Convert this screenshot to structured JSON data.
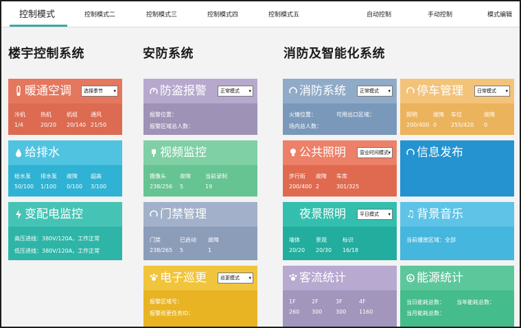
{
  "nav": {
    "tabs": [
      "控制模式",
      "控制模式二",
      "控制模式三",
      "控制模式四",
      "控制模式五"
    ],
    "right": [
      "自动控制",
      "手动控制",
      "模式编辑"
    ]
  },
  "sections": {
    "building": "楼宇控制系统",
    "security": "安防系统",
    "fire": "消防及智能化系统"
  },
  "colors": {
    "hvac": "#e5775e",
    "water": "#2fb6d8",
    "power": "#3cbbae",
    "alarm": "#a195b9",
    "video": "#73c89a",
    "access": "#8fa1bd",
    "patrol": "#e9b52c",
    "fire": "#7c9cbc",
    "lighting": "#e5775e",
    "landscape": "#26b1a2",
    "flow": "#a195b9",
    "parking": "#efb55c",
    "info": "#2593d0",
    "music": "#48b9e0",
    "energy": "#4cc08f"
  },
  "cards": {
    "hvac": {
      "title": "暖通空调",
      "select": "选择季节",
      "icon": "thermometer-icon",
      "stats": [
        {
          "label": "冷机",
          "value": "1/4"
        },
        {
          "label": "热机",
          "value": "20/20"
        },
        {
          "label": "机组",
          "value": "20/140"
        },
        {
          "label": "通风",
          "value": "21/50"
        }
      ]
    },
    "water": {
      "title": "给排水",
      "icon": "water-drop-icon",
      "stats": [
        {
          "label": "给水泵",
          "value": "50/100"
        },
        {
          "label": "排水泵",
          "value": "1/100"
        },
        {
          "label": "故障",
          "value": "0/100"
        },
        {
          "label": "超高",
          "value": "3/100"
        }
      ]
    },
    "power": {
      "title": "变配电监控",
      "icon": "lightning-icon",
      "lines": [
        "高压进线：380V/120A，工作正常",
        "低压进线：380V/120A，工作正常"
      ]
    },
    "alarm": {
      "title": "防盗报警",
      "select": "正常模式",
      "icon": "alarm-icon",
      "lines": [
        "报警位置：",
        "报警区域总人数："
      ]
    },
    "video": {
      "title": "视频监控",
      "icon": "camera-icon",
      "stats": [
        {
          "label": "摄像头",
          "value": "238/256"
        },
        {
          "label": "故障",
          "value": "5"
        },
        {
          "label": "当前录制",
          "value": "19"
        }
      ]
    },
    "access": {
      "title": "门禁管理",
      "icon": "door-icon",
      "stats": [
        {
          "label": "门禁",
          "value": "238/265"
        },
        {
          "label": "已启动",
          "value": "5"
        },
        {
          "label": "故障",
          "value": "1"
        }
      ]
    },
    "patrol": {
      "title": "电子巡更",
      "select": "巡更模式",
      "icon": "patrol-icon",
      "lines": [
        "报警区域号：",
        "报警巡更任务ID："
      ]
    },
    "fire": {
      "title": "消防系统",
      "select": "正常模式",
      "icon": "fire-icon",
      "lines": [
        "火情位置：",
        "场内总人数："
      ],
      "extra": "可用出口区域："
    },
    "lighting": {
      "title": "公共照明",
      "select": "营业时间模式",
      "icon": "bulb-icon",
      "stats": [
        {
          "label": "步行街",
          "value": "200/400"
        },
        {
          "label": "故障",
          "value": "2"
        },
        {
          "label": "车库",
          "value": "301/325"
        }
      ]
    },
    "landscape": {
      "title": "夜景照明",
      "select": "平日模式",
      "icon": "moon-icon",
      "stats": [
        {
          "label": "墙体",
          "value": "20/20"
        },
        {
          "label": "景观",
          "value": "20/30"
        },
        {
          "label": "标识",
          "value": "16/18"
        }
      ]
    },
    "flow": {
      "title": "客流统计",
      "icon": "people-icon",
      "stats": [
        {
          "label": "1F",
          "value": "260"
        },
        {
          "label": "2F",
          "value": "300"
        },
        {
          "label": "3F",
          "value": "300"
        },
        {
          "label": "4F",
          "value": "1160"
        }
      ]
    },
    "parking": {
      "title": "停车管理",
      "select": "日常模式",
      "icon": "car-icon",
      "stats": [
        {
          "label": "照明",
          "value": "200/400"
        },
        {
          "label": "故障",
          "value": "0"
        },
        {
          "label": "车位",
          "value": "255/420"
        },
        {
          "label": "故障",
          "value": "0"
        }
      ]
    },
    "info": {
      "title": "信息发布",
      "icon": "broadcast-icon"
    },
    "music": {
      "title": "背景音乐",
      "icon": "music-note-icon",
      "lines": [
        "当前播放区域：全部"
      ]
    },
    "energy": {
      "title": "能源统计",
      "icon": "energy-icon",
      "lines": [
        "当日能耗总数：",
        "当月能耗总数："
      ],
      "extra": "当年能耗总数："
    }
  }
}
